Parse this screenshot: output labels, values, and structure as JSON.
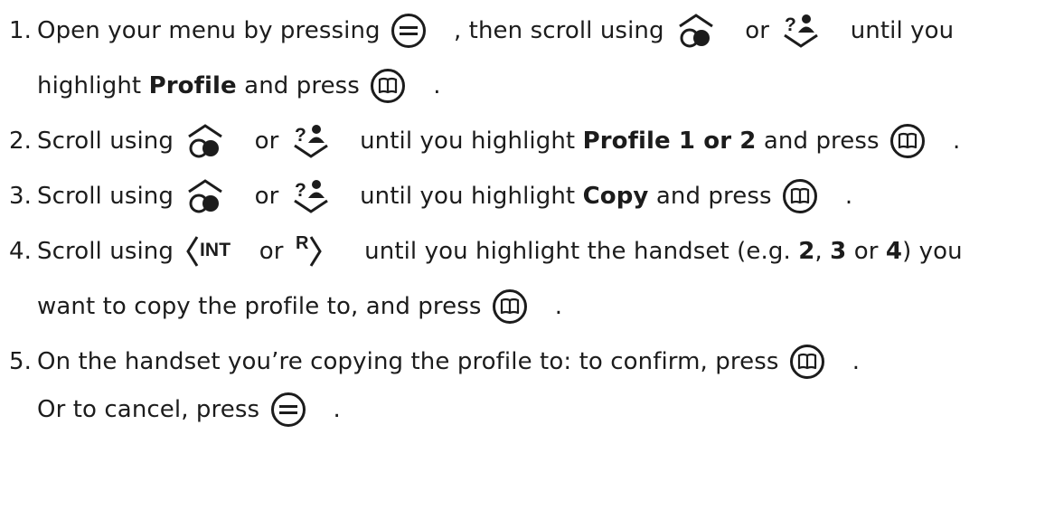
{
  "steps": [
    {
      "number": "1.",
      "line1": {
        "t1": "Open your menu by pressing ",
        "t2": ", then scroll using ",
        "t3": " or ",
        "t4": " until you"
      },
      "line2": {
        "t1": "highlight ",
        "bold1": "Profile",
        "t2": " and press ",
        "t3": "."
      }
    },
    {
      "number": "2.",
      "line1": {
        "t1": "Scroll using ",
        "t2": " or ",
        "t3": " until you highlight ",
        "bold1": "Profile 1 or 2",
        "t4": " and press ",
        "t5": "."
      }
    },
    {
      "number": "3.",
      "line1": {
        "t1": "Scroll using ",
        "t2": " or ",
        "t3": " until you highlight ",
        "bold1": "Copy",
        "t4": " and press ",
        "t5": "."
      }
    },
    {
      "number": "4.",
      "line1": {
        "t1": "Scroll using ",
        "t2": " or ",
        "t3": " until you highlight the handset (e.g. ",
        "bold1": "2",
        "t4": ", ",
        "bold2": "3",
        "t5": " or ",
        "bold3": "4",
        "t6": ") you"
      },
      "line2": {
        "t1": "want to copy the profile to, and press ",
        "t2": "."
      }
    },
    {
      "number": "5.",
      "line1": {
        "t1": "On the handset you’re copying the profile to: to confirm, press ",
        "t2": "."
      },
      "line2": {
        "t1": "Or to cancel, press ",
        "t2": "."
      }
    }
  ],
  "key_labels": {
    "int": "INT",
    "r": "R",
    "question_mark": "?"
  },
  "icons": {
    "menu": "menu-button-icon",
    "up": "scroll-up-contacts-icon",
    "down": "scroll-down-calls-icon",
    "ok": "ok-book-button-icon",
    "left": "left-int-icon",
    "right": "right-r-icon"
  },
  "colors": {
    "text": "#1c1c1c",
    "background": "#ffffff"
  }
}
